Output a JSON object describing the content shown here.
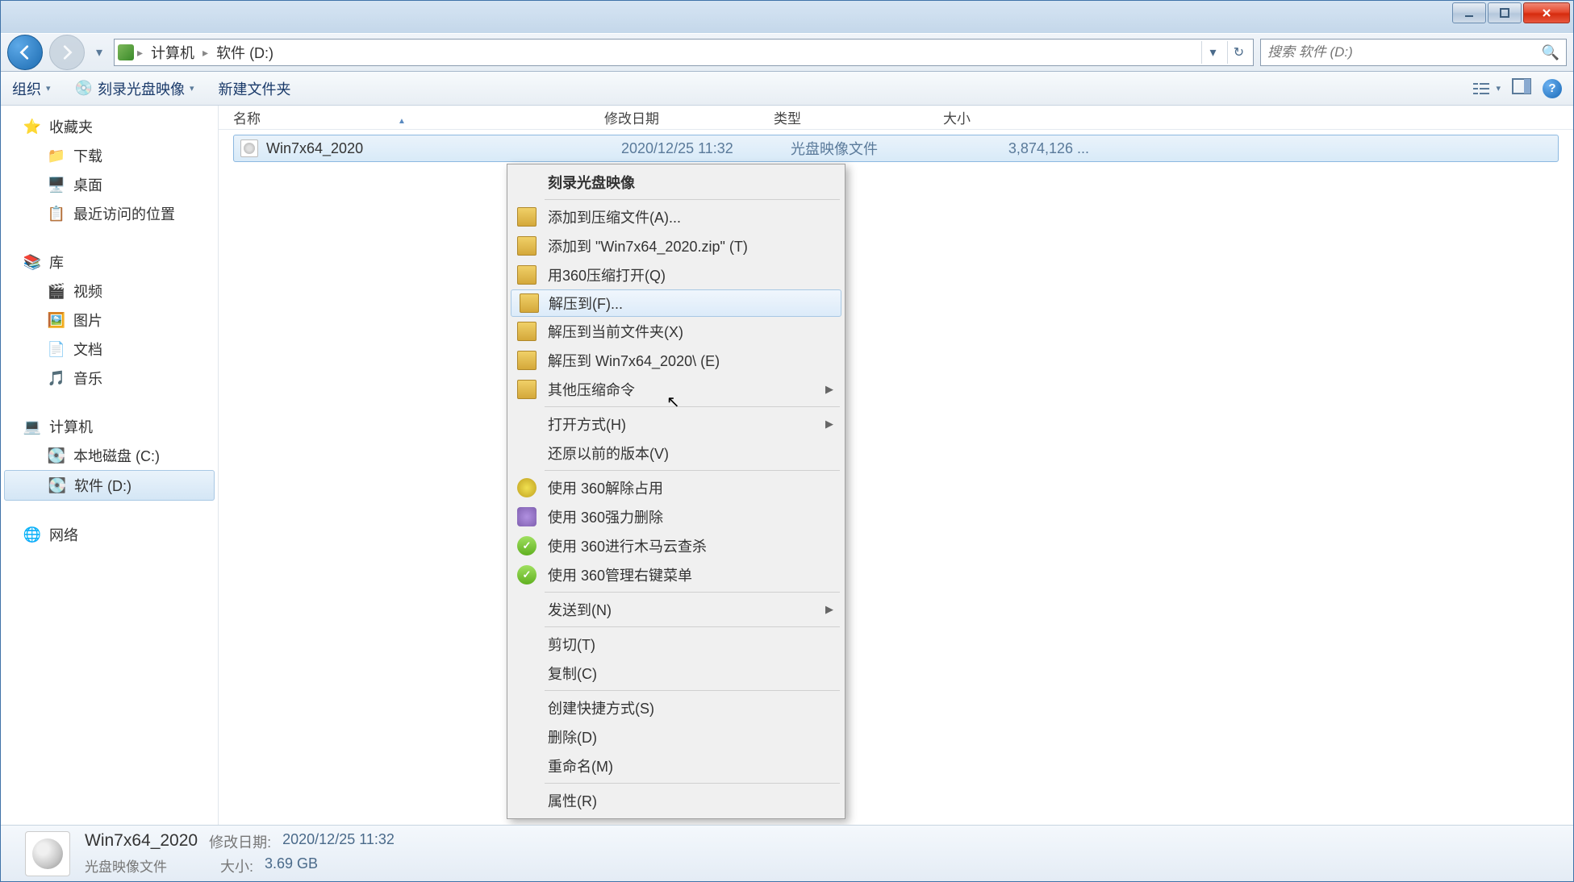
{
  "breadcrumb": {
    "seg1": "计算机",
    "seg2": "软件 (D:)"
  },
  "search": {
    "placeholder": "搜索 软件 (D:)"
  },
  "toolbar": {
    "organize": "组织",
    "burn": "刻录光盘映像",
    "newfolder": "新建文件夹"
  },
  "sidebar": {
    "favorites": {
      "title": "收藏夹",
      "downloads": "下载",
      "desktop": "桌面",
      "recent": "最近访问的位置"
    },
    "libraries": {
      "title": "库",
      "videos": "视频",
      "pictures": "图片",
      "documents": "文档",
      "music": "音乐"
    },
    "computer": {
      "title": "计算机",
      "localc": "本地磁盘 (C:)",
      "softwared": "软件 (D:)"
    },
    "network": {
      "title": "网络"
    }
  },
  "columns": {
    "name": "名称",
    "date": "修改日期",
    "type": "类型",
    "size": "大小"
  },
  "file": {
    "name": "Win7x64_2020",
    "date": "2020/12/25 11:32",
    "type": "光盘映像文件",
    "size": "3,874,126 ..."
  },
  "context_menu": {
    "burn_image": "刻录光盘映像",
    "add_archive": "添加到压缩文件(A)...",
    "add_to_zip": "添加到 \"Win7x64_2020.zip\" (T)",
    "open_360zip": "用360压缩打开(Q)",
    "extract_to": "解压到(F)...",
    "extract_here": "解压到当前文件夹(X)",
    "extract_to_folder": "解压到 Win7x64_2020\\ (E)",
    "other_zip": "其他压缩命令",
    "open_with": "打开方式(H)",
    "restore": "还原以前的版本(V)",
    "unlock_360": "使用 360解除占用",
    "force_del_360": "使用 360强力删除",
    "trojan_360": "使用 360进行木马云查杀",
    "manage_360": "使用 360管理右键菜单",
    "send_to": "发送到(N)",
    "cut": "剪切(T)",
    "copy": "复制(C)",
    "shortcut": "创建快捷方式(S)",
    "delete": "删除(D)",
    "rename": "重命名(M)",
    "properties": "属性(R)"
  },
  "statusbar": {
    "name": "Win7x64_2020",
    "date_label": "修改日期:",
    "date": "2020/12/25 11:32",
    "type": "光盘映像文件",
    "size_label": "大小:",
    "size": "3.69 GB"
  }
}
